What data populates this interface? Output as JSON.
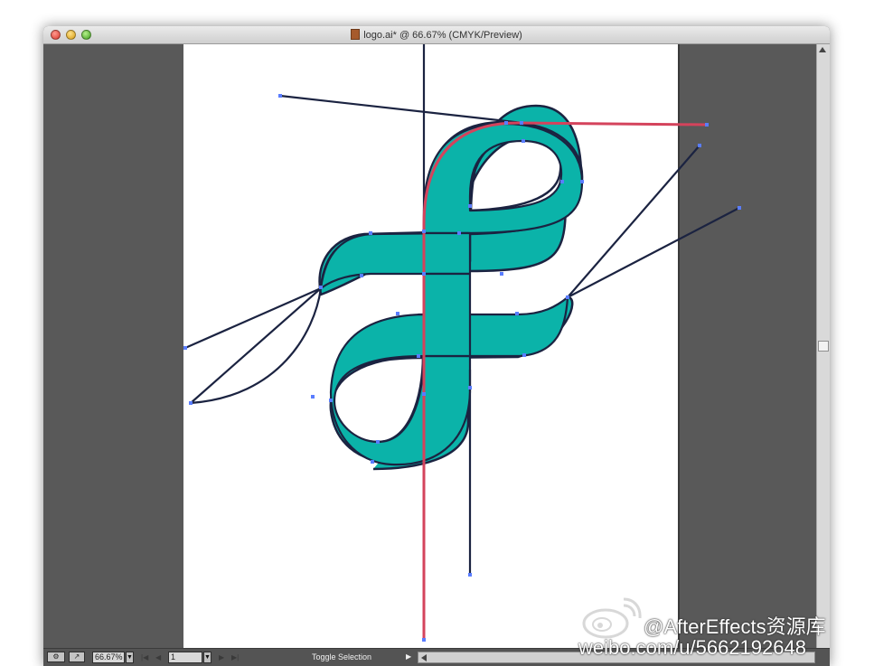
{
  "window": {
    "title": "logo.ai* @ 66.67% (CMYK/Preview)",
    "doc_icon": "illustrator-document-icon"
  },
  "statusbar": {
    "zoom": "66.67%",
    "page": "1",
    "tool_label": "Toggle Selection"
  },
  "colors": {
    "fill": "#0bb3a9",
    "path_outline": "#1b2341",
    "guide_red": "#d4435c",
    "anchor_point": "#5a7dff",
    "pasteboard": "#595959",
    "artboard": "#ffffff"
  },
  "watermark": {
    "line1": "@AfterEffects资源库",
    "line2": "weibo.com/u/5662192648",
    "icon": "weibo-logo-icon"
  }
}
